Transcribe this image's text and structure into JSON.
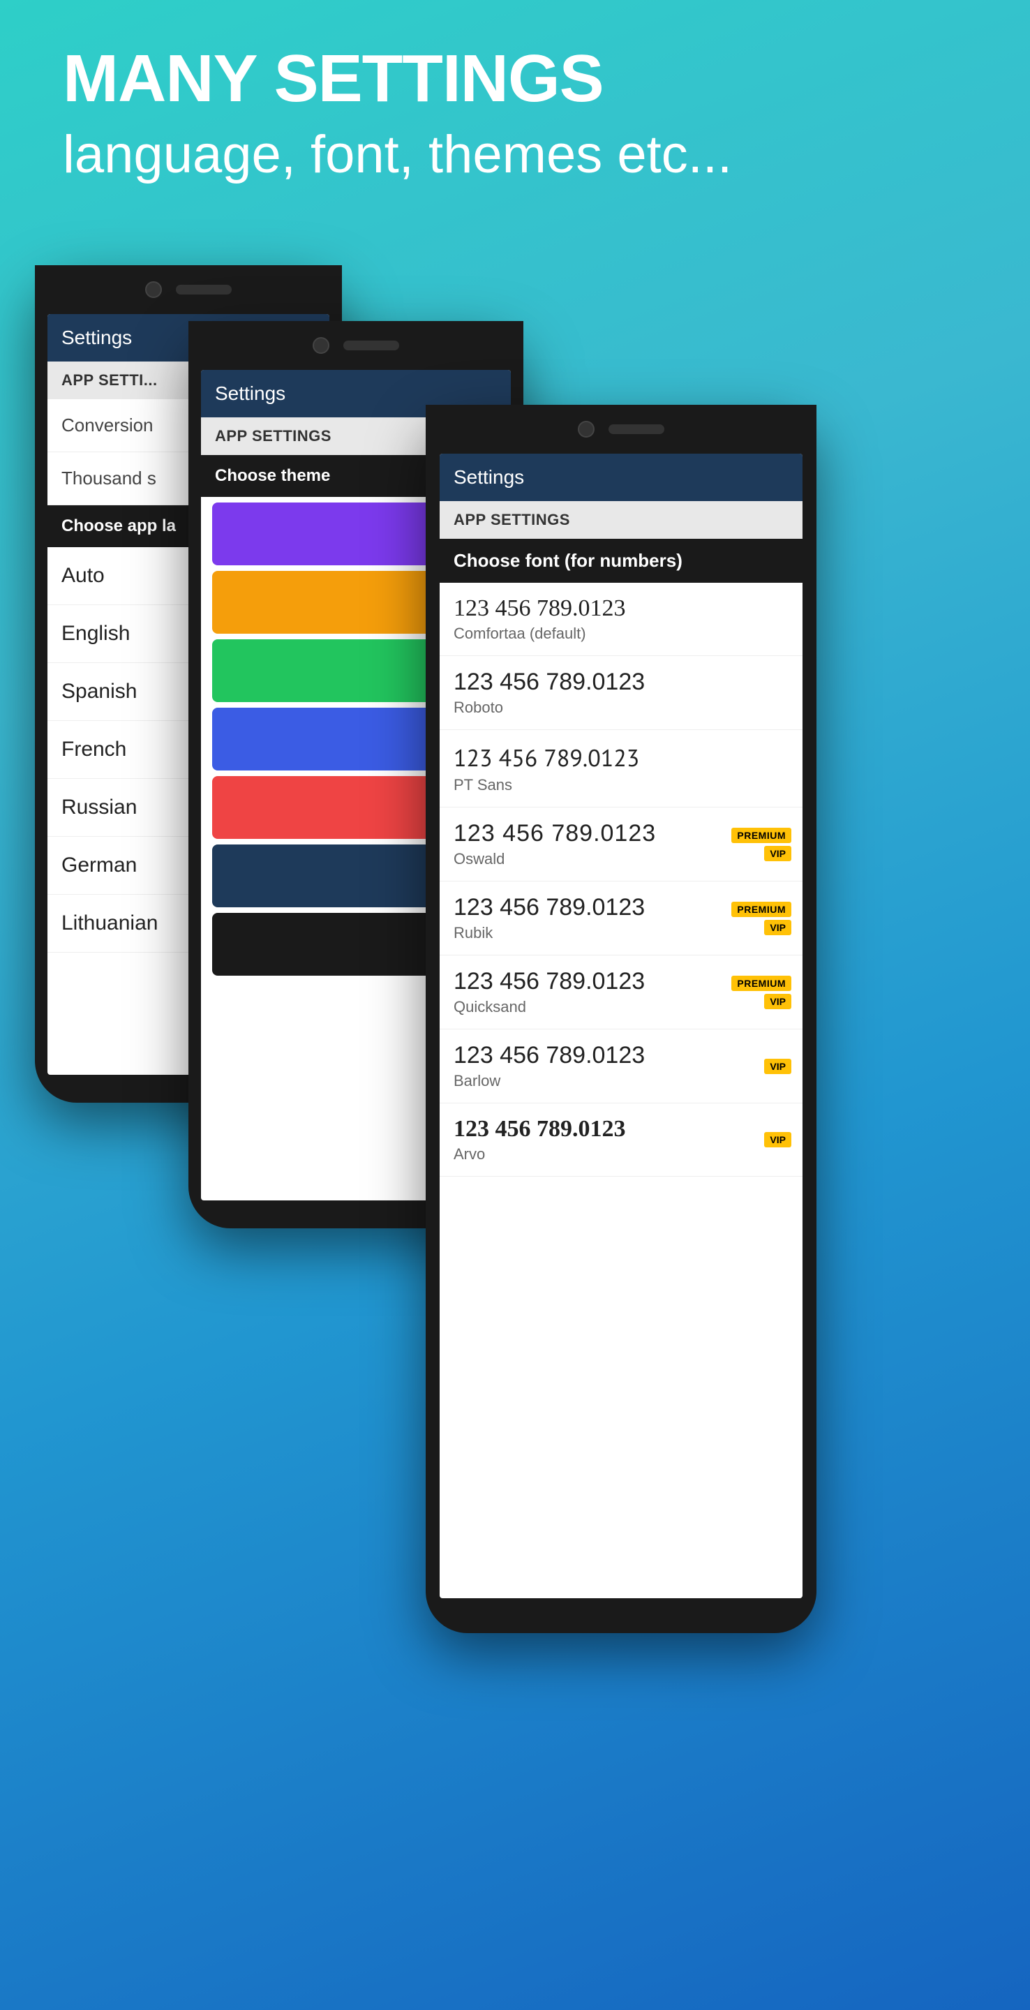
{
  "header": {
    "title": "MANY SETTINGS",
    "subtitle": "language, font, themes etc..."
  },
  "phone1": {
    "type": "language",
    "settings_label": "Settings",
    "app_settings": "APP SETTINGS",
    "settings_items": [
      "Conversion",
      "Thousand s"
    ],
    "dropdown_header": "Choose app la",
    "languages": [
      "Auto",
      "English",
      "Spanish",
      "French",
      "Russian",
      "German",
      "Lithuanian"
    ]
  },
  "phone2": {
    "type": "theme",
    "settings_label": "Settings",
    "app_settings": "APP SETTINGS",
    "theme_header": "Choose theme",
    "themes": [
      {
        "color": "#7c3aed",
        "name": "purple"
      },
      {
        "color": "#f59e0b",
        "name": "orange"
      },
      {
        "color": "#22c55e",
        "name": "green"
      },
      {
        "color": "#3b5ce4",
        "name": "blue"
      },
      {
        "color": "#ef4444",
        "name": "red"
      },
      {
        "color": "#1e3a5a",
        "name": "dark-navy"
      },
      {
        "color": "#1a1a1a",
        "name": "black"
      }
    ]
  },
  "phone3": {
    "type": "font",
    "settings_label": "Settings",
    "app_settings": "APP SETTINGS",
    "font_header": "Choose font (for numbers)",
    "fonts": [
      {
        "number": "123 456 789.0123",
        "name": "Comfortaa (default)",
        "premium": false,
        "vip": false
      },
      {
        "number": "123 456 789.0123",
        "name": "Roboto",
        "premium": false,
        "vip": false
      },
      {
        "number": "123 456 789.0123",
        "name": "PT Sans",
        "premium": false,
        "vip": false
      },
      {
        "number": "123 456 789.0123",
        "name": "Oswald",
        "premium": true,
        "vip": true
      },
      {
        "number": "123 456 789.0123",
        "name": "Rubik",
        "premium": true,
        "vip": true
      },
      {
        "number": "123 456 789.0123",
        "name": "Quicksand",
        "premium": true,
        "vip": true
      },
      {
        "number": "123 456 789.0123",
        "name": "Barlow",
        "premium": false,
        "vip": true
      },
      {
        "number": "123 456 789.0123",
        "name": "Arvo",
        "premium": false,
        "vip": true
      }
    ]
  },
  "badges": {
    "premium": "PREMIUM",
    "vip": "VIP"
  }
}
